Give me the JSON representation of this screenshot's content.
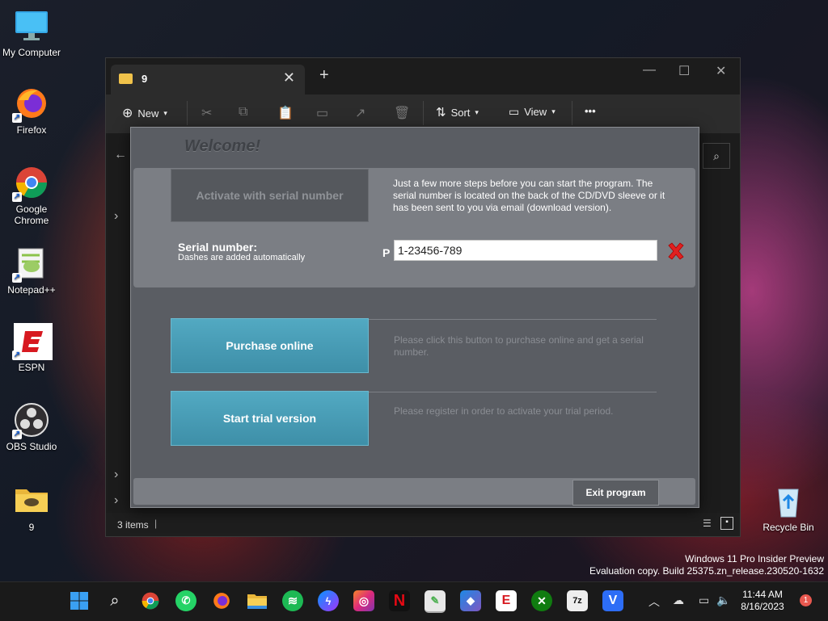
{
  "desktop": {
    "icons": [
      {
        "label": "My Computer"
      },
      {
        "label": "Firefox"
      },
      {
        "label": "Google Chrome"
      },
      {
        "label": "Notepad++"
      },
      {
        "label": "ESPN"
      },
      {
        "label": "OBS Studio"
      },
      {
        "label": "9"
      },
      {
        "label": "Recycle Bin"
      }
    ],
    "watermark_line1": "Windows 11 Pro Insider Preview",
    "watermark_line2": "Evaluation copy. Build 25375.zn_release.230520-1632"
  },
  "explorer": {
    "tab_title": "9",
    "toolbar": {
      "new_label": "New",
      "sort_label": "Sort",
      "view_label": "View",
      "more_label": "•••"
    },
    "status_items": "3 items"
  },
  "dialog": {
    "title": "Welcome!",
    "activate_label": "Activate with serial number",
    "activate_info": "Just a few more steps before you can start the program. The serial number is located on the back of the CD/DVD sleeve or it has been sent to you via email (download version).",
    "serial_label": "Serial number:",
    "serial_sub": "Dashes are added automatically",
    "serial_prefix": "P",
    "serial_value": "1-23456-789",
    "purchase_label": "Purchase online",
    "purchase_info": "Please click this button to purchase online and get a serial number.",
    "trial_label": "Start trial version",
    "trial_info": "Please register in order to activate your trial period.",
    "exit_label": "Exit program"
  },
  "taskbar": {
    "time": "11:44 AM",
    "date": "8/16/2023",
    "notification_count": "1"
  },
  "colors": {
    "dialog_bg": "#5a5d63",
    "panel_bg": "#7b7e84",
    "teal_button": "#4a9fb8",
    "clear_x": "#e02020"
  }
}
